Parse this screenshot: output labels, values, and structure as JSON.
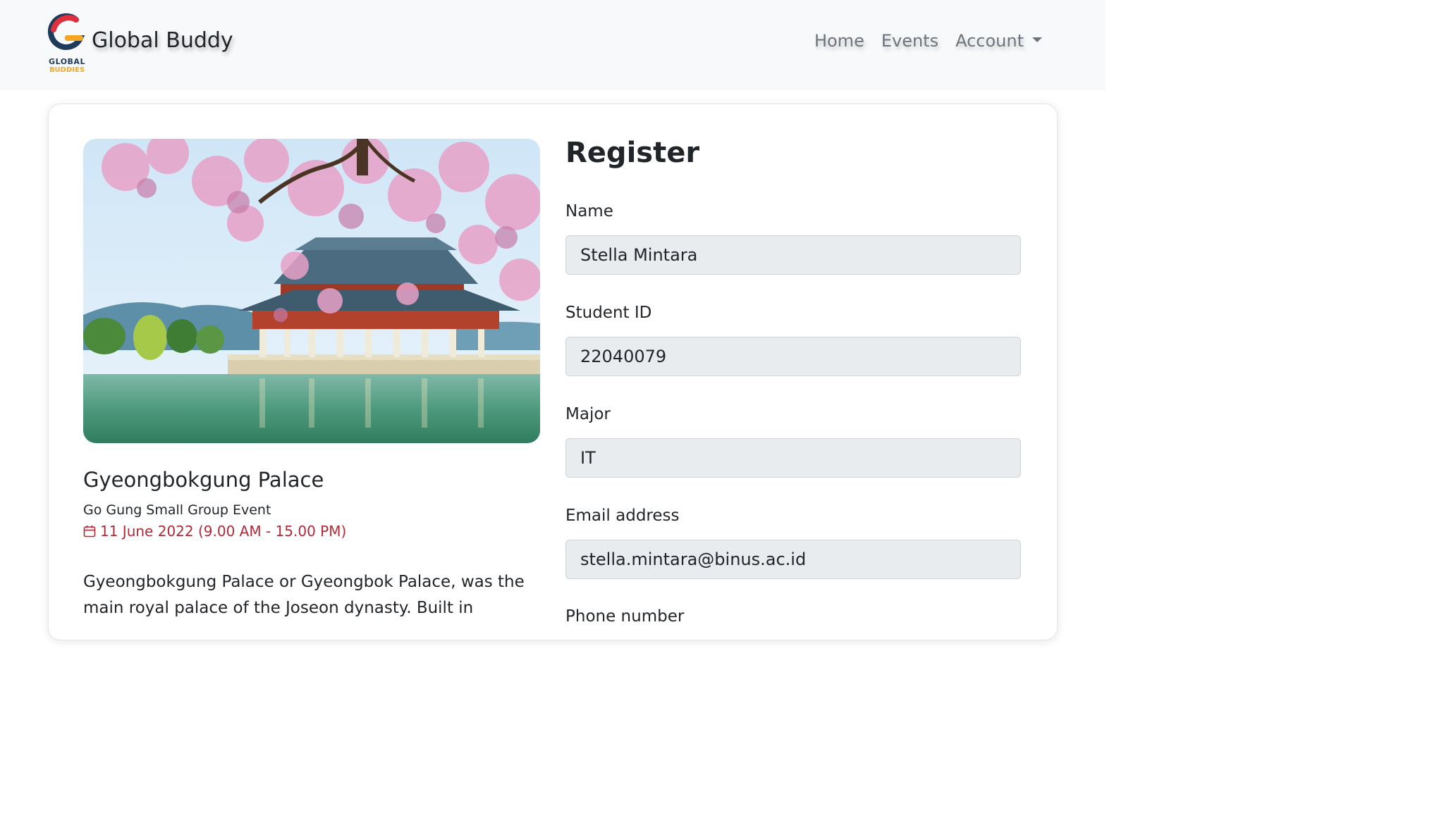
{
  "navbar": {
    "logo": {
      "line1": "GLOBAL",
      "line2": "BUDDIES"
    },
    "brand": "Global Buddy",
    "links": [
      {
        "label": "Home"
      },
      {
        "label": "Events"
      },
      {
        "label": "Account"
      }
    ]
  },
  "event": {
    "title": "Gyeongbokgung Palace",
    "subtitle": "Go Gung Small Group Event",
    "date": "11 June 2022 (9.00 AM - 15.00 PM)",
    "description": "Gyeongbokgung Palace or Gyeongbok Palace, was the main royal palace of the Joseon dynasty. Built in"
  },
  "form": {
    "title": "Register",
    "fields": [
      {
        "label": "Name",
        "value": "Stella Mintara"
      },
      {
        "label": "Student ID",
        "value": "22040079"
      },
      {
        "label": "Major",
        "value": "IT"
      },
      {
        "label": "Email address",
        "value": "stella.mintara@binus.ac.id"
      },
      {
        "label": "Phone number"
      }
    ]
  },
  "colors": {
    "navbar_bg": "#f8f9fa",
    "date_red": "#b02a37",
    "input_bg": "#e9ecef",
    "logo_navy": "#1f3b5c",
    "logo_red": "#e0303e",
    "logo_yellow": "#f5a623"
  },
  "icons": [
    "calendar-icon",
    "dropdown-caret-icon",
    "global-buddies-logo"
  ]
}
